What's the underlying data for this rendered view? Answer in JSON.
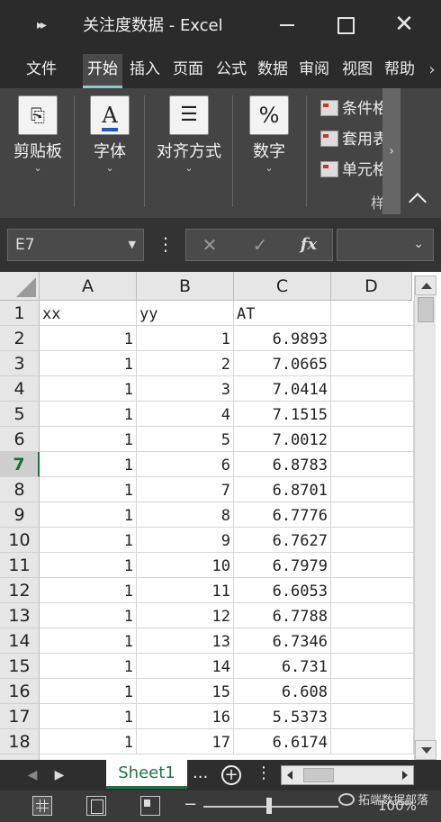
{
  "window": {
    "title": "关注度数据  -  Excel",
    "qat_icon": "quick-access-overflow-icon"
  },
  "tabs": [
    "文件",
    "开始",
    "插入",
    "页面",
    "公式",
    "数据",
    "审阅",
    "视图",
    "帮助"
  ],
  "tabs_scroll": "›",
  "ribbon": {
    "groups": [
      {
        "label": "剪贴板",
        "icon": "clipboard-icon",
        "glyph": "📋"
      },
      {
        "label": "字体",
        "icon": "font-color-icon",
        "glyph": "A"
      },
      {
        "label": "对齐方式",
        "icon": "align-icon",
        "glyph": "☰"
      },
      {
        "label": "数字",
        "icon": "percent-icon",
        "glyph": "%"
      }
    ],
    "caret": "⌄",
    "styles": [
      "条件格式",
      "套用表格格式",
      "单元格样式"
    ],
    "styles_group_label": "样",
    "scroll": "›"
  },
  "formula_bar": {
    "name_box": "E7",
    "dots": "⋮",
    "cancel": "✕",
    "enter": "✓",
    "fx": "fx",
    "value": ""
  },
  "grid": {
    "columns": [
      "A",
      "B",
      "C",
      "D"
    ],
    "rows": [
      {
        "n": "1",
        "a": "xx",
        "b": "yy",
        "c": "AT"
      },
      {
        "n": "2",
        "a": "1",
        "b": "1",
        "c": "6.9893"
      },
      {
        "n": "3",
        "a": "1",
        "b": "2",
        "c": "7.0665"
      },
      {
        "n": "4",
        "a": "1",
        "b": "3",
        "c": "7.0414"
      },
      {
        "n": "5",
        "a": "1",
        "b": "4",
        "c": "7.1515"
      },
      {
        "n": "6",
        "a": "1",
        "b": "5",
        "c": "7.0012"
      },
      {
        "n": "7",
        "a": "1",
        "b": "6",
        "c": "6.8783"
      },
      {
        "n": "8",
        "a": "1",
        "b": "7",
        "c": "6.8701"
      },
      {
        "n": "9",
        "a": "1",
        "b": "8",
        "c": "6.7776"
      },
      {
        "n": "10",
        "a": "1",
        "b": "9",
        "c": "6.7627"
      },
      {
        "n": "11",
        "a": "1",
        "b": "10",
        "c": "6.7979"
      },
      {
        "n": "12",
        "a": "1",
        "b": "11",
        "c": "6.6053"
      },
      {
        "n": "13",
        "a": "1",
        "b": "12",
        "c": "6.7788"
      },
      {
        "n": "14",
        "a": "1",
        "b": "13",
        "c": "6.7346"
      },
      {
        "n": "15",
        "a": "1",
        "b": "14",
        "c": "6.731"
      },
      {
        "n": "16",
        "a": "1",
        "b": "15",
        "c": "6.608"
      },
      {
        "n": "17",
        "a": "1",
        "b": "16",
        "c": "5.5373"
      },
      {
        "n": "18",
        "a": "1",
        "b": "17",
        "c": "6.6174"
      }
    ],
    "selected_row": "7"
  },
  "sheets": {
    "active": "Sheet1",
    "prev": "◀",
    "next": "▶",
    "more": "...",
    "add": "+",
    "menu": "⋮"
  },
  "status": {
    "zoom_minus": "−",
    "zoom": "100%",
    "watermark": "拓端数据部落"
  },
  "colors": {
    "accent": "#217346",
    "titlebar": "#2b2b2b",
    "ribbon": "#444444"
  }
}
